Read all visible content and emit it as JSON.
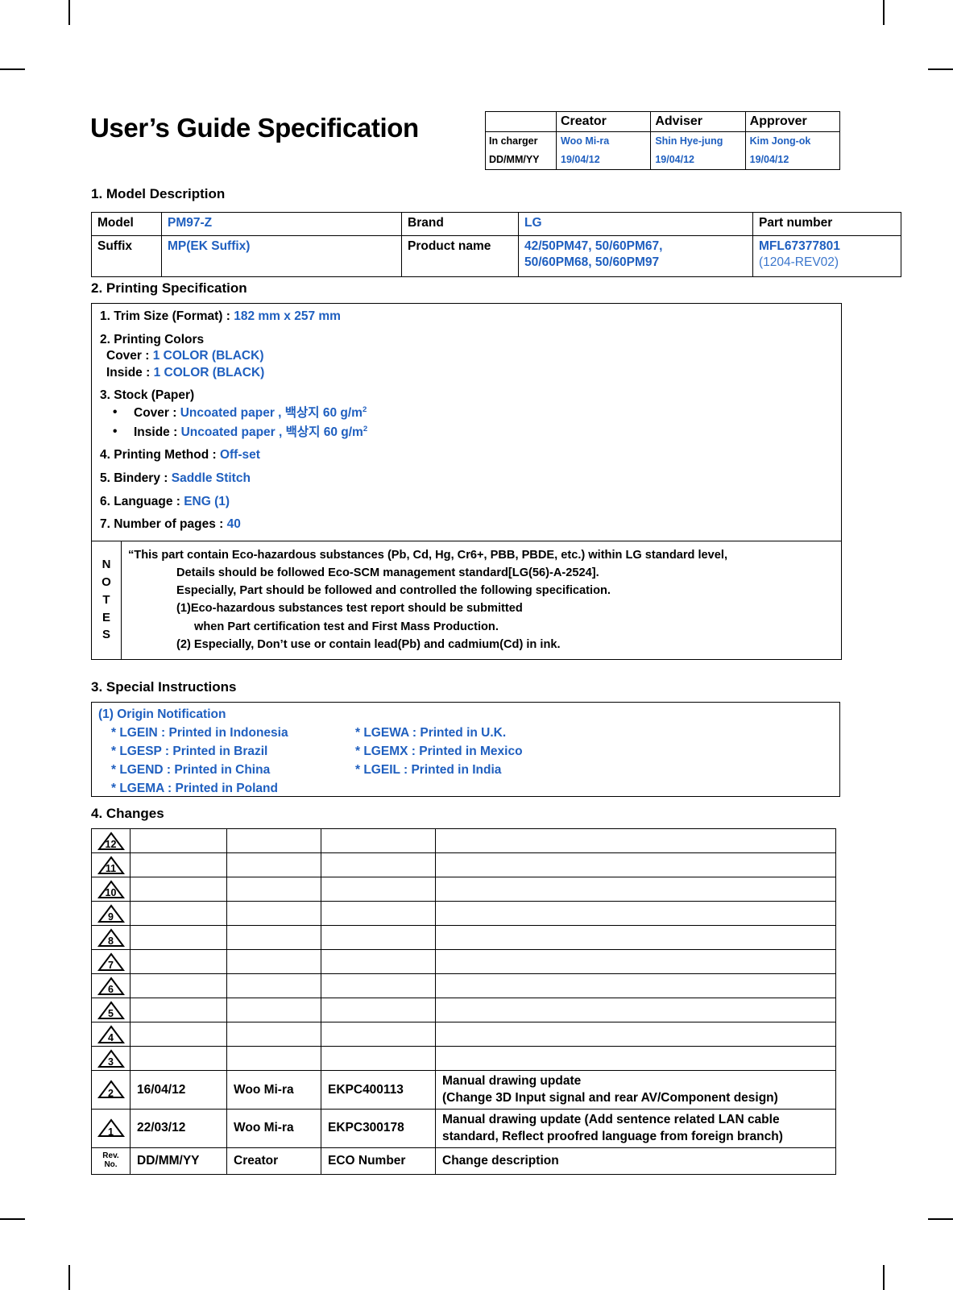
{
  "title": "User’s Guide Specification",
  "approval": {
    "columns": [
      "",
      "Creator",
      "Adviser",
      "Approver"
    ],
    "rows": [
      {
        "label": "In charger",
        "values": [
          "Woo Mi-ra",
          "Shin Hye-jung",
          "Kim Jong-ok"
        ]
      },
      {
        "label": "DD/MM/YY",
        "values": [
          "19/04/12",
          "19/04/12",
          "19/04/12"
        ]
      }
    ]
  },
  "sections": {
    "model": "1. Model Description",
    "printing": "2. Printing Specification",
    "special": "3. Special Instructions",
    "changes": "4. Changes"
  },
  "model_table": {
    "row1": {
      "label1": "Model",
      "value1": "PM97-Z",
      "label2": "Brand",
      "value2": "LG",
      "label3": "Part number"
    },
    "row2": {
      "label1": "Suffix",
      "value1": "MP(EK Suffix)",
      "label2": "Product name",
      "value2_line1": "42/50PM47, 50/60PM67,",
      "value2_line2": "50/60PM68, 50/60PM97",
      "value3_line1": "MFL67377801",
      "value3_line2": "(1204-REV02)"
    }
  },
  "printing_spec": {
    "trim_label": "1. Trim Size (Format) :",
    "trim_value": "182 mm x 257 mm",
    "colors_label": "2. Printing Colors",
    "colors_cover_label": "Cover :",
    "colors_cover_value": "1 COLOR (BLACK)",
    "colors_inside_label": "Inside :",
    "colors_inside_value": "1 COLOR (BLACK)",
    "stock_label": "3. Stock (Paper)",
    "stock_cover_label": "Cover :",
    "stock_cover_value": "Uncoated paper , 백상지 60 g/m",
    "stock_cover_sup": "2",
    "stock_inside_label": "Inside :",
    "stock_inside_value": "Uncoated paper , 백상지 60 g/m",
    "stock_inside_sup": "2",
    "method_label": "4. Printing Method :",
    "method_value": "Off-set",
    "bindery_label": "5. Bindery  :",
    "bindery_value": "Saddle Stitch",
    "language_label": "6. Language :",
    "language_value": "ENG (1)",
    "pages_label": "7. Number of pages :",
    "pages_value": "40",
    "bullet": "•"
  },
  "notes": {
    "label_letters": [
      "N",
      "O",
      "T",
      "E",
      "S"
    ],
    "lines": [
      "“This part contain Eco-hazardous substances (Pb, Cd, Hg, Cr6+, PBB, PBDE, etc.) within LG standard level,",
      "Details should be followed Eco-SCM management standard[LG(56)-A-2524].",
      "Especially, Part should be followed and controlled the following specification.",
      "(1)Eco-hazardous substances test report should be submitted",
      "when  Part certification test and First Mass Production.",
      "(2) Especially, Don’t use or contain lead(Pb) and cadmium(Cd) in ink."
    ]
  },
  "special_instructions": {
    "heading": "(1) Origin Notification",
    "rows": [
      {
        "left": "* LGEIN : Printed in Indonesia",
        "right": "* LGEWA : Printed in U.K."
      },
      {
        "left": "* LGESP : Printed in Brazil",
        "right": "* LGEMX : Printed in Mexico"
      },
      {
        "left": "* LGEND : Printed in China",
        "right": "* LGEIL : Printed in India"
      },
      {
        "left": "* LGEMA : Printed in Poland",
        "right": ""
      }
    ]
  },
  "changes": {
    "rows": [
      {
        "rev": "12",
        "date": "",
        "creator": "",
        "eco": "",
        "desc_line1": "",
        "desc_line2": ""
      },
      {
        "rev": "11",
        "date": "",
        "creator": "",
        "eco": "",
        "desc_line1": "",
        "desc_line2": ""
      },
      {
        "rev": "10",
        "date": "",
        "creator": "",
        "eco": "",
        "desc_line1": "",
        "desc_line2": ""
      },
      {
        "rev": "9",
        "date": "",
        "creator": "",
        "eco": "",
        "desc_line1": "",
        "desc_line2": ""
      },
      {
        "rev": "8",
        "date": "",
        "creator": "",
        "eco": "",
        "desc_line1": "",
        "desc_line2": ""
      },
      {
        "rev": "7",
        "date": "",
        "creator": "",
        "eco": "",
        "desc_line1": "",
        "desc_line2": ""
      },
      {
        "rev": "6",
        "date": "",
        "creator": "",
        "eco": "",
        "desc_line1": "",
        "desc_line2": ""
      },
      {
        "rev": "5",
        "date": "",
        "creator": "",
        "eco": "",
        "desc_line1": "",
        "desc_line2": ""
      },
      {
        "rev": "4",
        "date": "",
        "creator": "",
        "eco": "",
        "desc_line1": "",
        "desc_line2": ""
      },
      {
        "rev": "3",
        "date": "",
        "creator": "",
        "eco": "",
        "desc_line1": "",
        "desc_line2": ""
      },
      {
        "rev": "2",
        "date": "16/04/12",
        "creator": "Woo Mi-ra",
        "eco": "EKPC400113",
        "desc_line1": "Manual drawing update",
        "desc_line2": "(Change 3D Input signal and rear AV/Component design)"
      },
      {
        "rev": "1",
        "date": "22/03/12",
        "creator": "Woo Mi-ra",
        "eco": "EKPC300178",
        "desc_line1": "Manual drawing update (Add sentence related LAN cable",
        "desc_line2": "standard, Reflect proofred language from foreign branch)"
      }
    ],
    "footer": {
      "rev_line1": "Rev.",
      "rev_line2": "No.",
      "date": "DD/MM/YY",
      "creator": "Creator",
      "eco": "ECO Number",
      "desc": "Change description"
    }
  },
  "colors": {
    "accent_blue": "#1f5fbf",
    "accent_blue_light": "#3b76cc",
    "rule": "#000000"
  }
}
